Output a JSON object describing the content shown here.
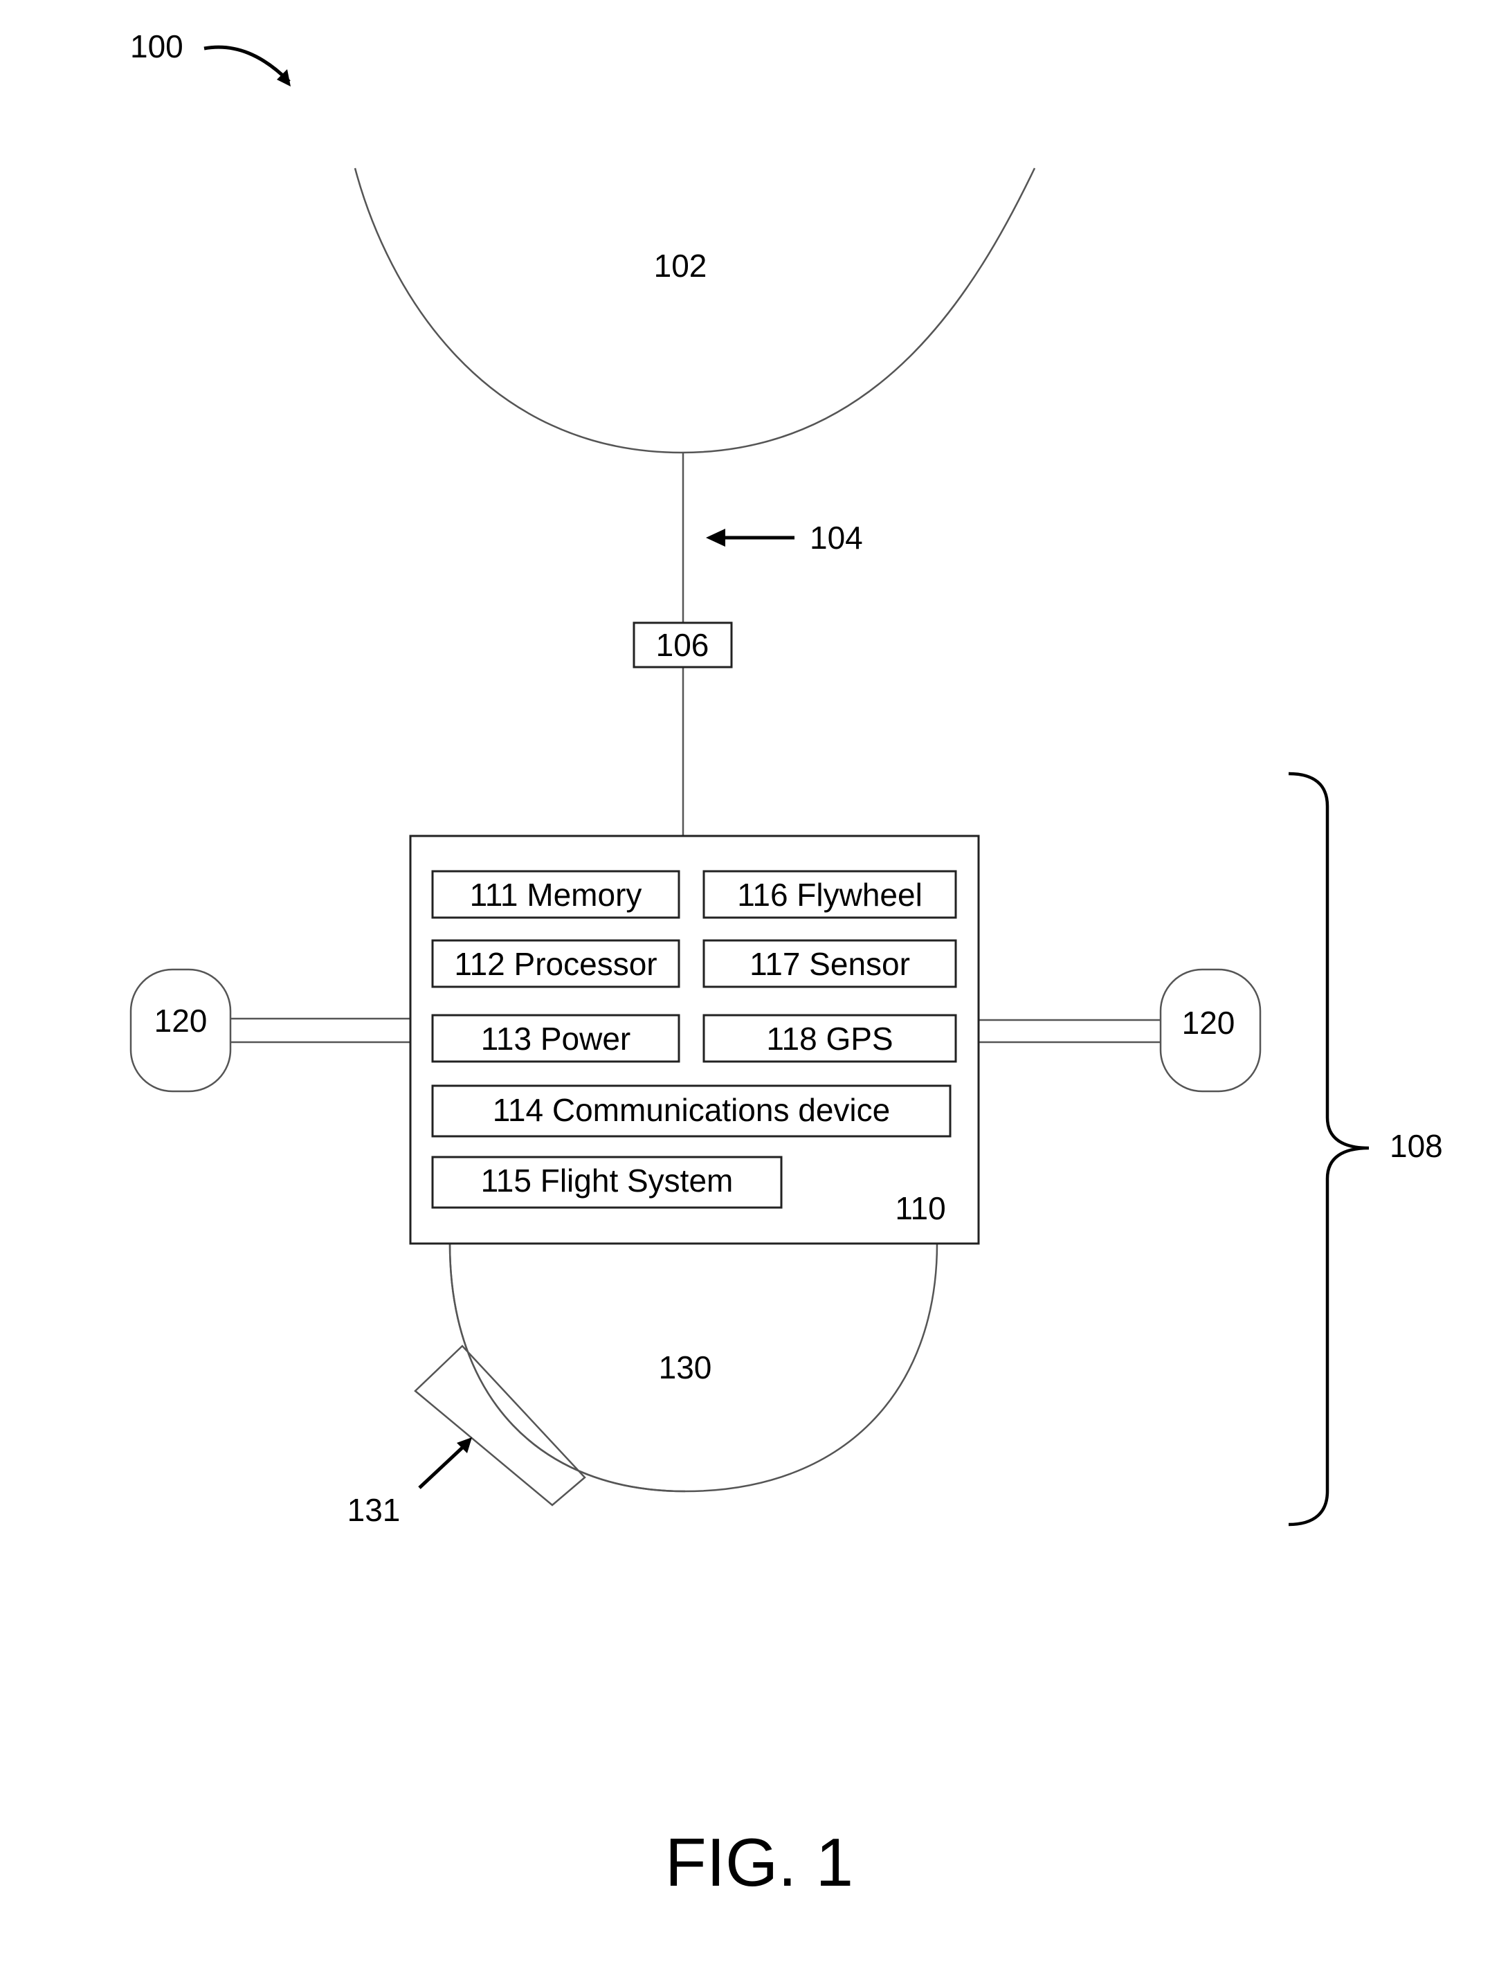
{
  "figure": {
    "caption": "FIG. 1",
    "system_ref": "100",
    "balloon_ref": "102",
    "tether_ref": "104",
    "connector_ref": "106",
    "payload_ref": "108",
    "control_box_ref": "110",
    "propulsion_ref_left": "120",
    "propulsion_ref_right": "120",
    "dome_ref": "130",
    "camera_ref": "131",
    "components": [
      {
        "id": "111",
        "label": "111 Memory"
      },
      {
        "id": "112",
        "label": "112 Processor"
      },
      {
        "id": "113",
        "label": "113 Power"
      },
      {
        "id": "114",
        "label": "114 Communications device"
      },
      {
        "id": "115",
        "label": "115 Flight System"
      },
      {
        "id": "116",
        "label": "116 Flywheel"
      },
      {
        "id": "117",
        "label": "117 Sensor"
      },
      {
        "id": "118",
        "label": "118 GPS"
      }
    ]
  }
}
